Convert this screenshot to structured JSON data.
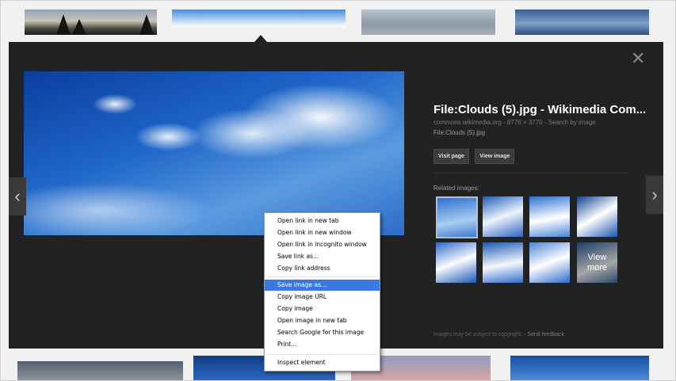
{
  "overlay": {
    "close_glyph": "✕",
    "prev_glyph": "‹",
    "next_glyph": "›",
    "title": "File:Clouds (5).jpg - Wikimedia Com...",
    "meta": "commons.wikimedia.org - 8776 × 3770 - Search by image",
    "file": "File:Clouds (5).jpg",
    "buttons": [
      "Visit page",
      "View image"
    ],
    "related_label": "Related images:",
    "view_more": "View more",
    "footer_note": "Images may be subject to copyright.",
    "footer_sep": " - ",
    "send_feedback": "Send feedback"
  },
  "context_menu": {
    "group1": [
      "Open link in new tab",
      "Open link in new window",
      "Open link in incognito window",
      "Save link as...",
      "Copy link address"
    ],
    "group2": [
      "Save image as...",
      "Copy image URL",
      "Copy image",
      "Open image in new tab",
      "Search Google for this image",
      "Print..."
    ],
    "group3": [
      "Inspect element"
    ],
    "active_item": "Save image as..."
  },
  "colors": {
    "panel_bg": "#222222",
    "menu_highlight": "#3b79e0"
  }
}
